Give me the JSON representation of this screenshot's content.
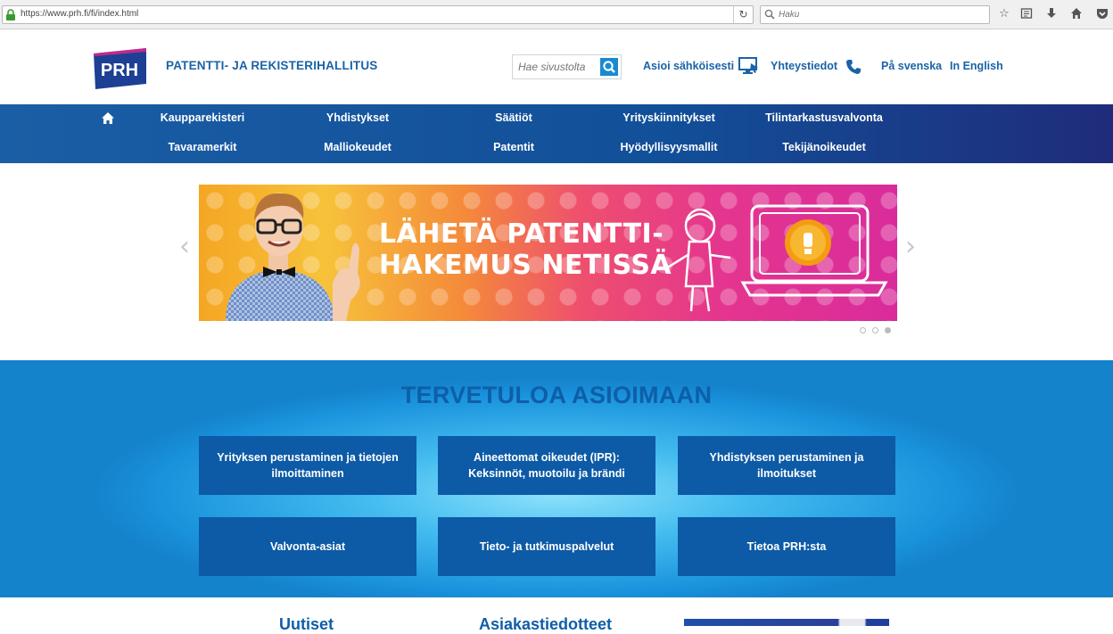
{
  "browser": {
    "url": "https://www.prh.fi/fi/index.html",
    "search_placeholder": "Haku",
    "icons": [
      "lock-icon",
      "reload-icon",
      "search-icon",
      "bookmark-star-icon",
      "reading-list-icon",
      "download-icon",
      "home-icon",
      "pocket-icon"
    ]
  },
  "header": {
    "logo_text": "PRH",
    "site_name": "PATENTTI- JA REKISTERIHALLITUS",
    "search_placeholder": "Hae sivustolta",
    "links": {
      "eservice": "Asioi sähköisesti",
      "contact": "Yhteystiedot",
      "swedish": "På svenska",
      "english": "In English"
    }
  },
  "nav": {
    "row1": [
      "Kaupparekisteri",
      "Yhdistykset",
      "Säätiöt",
      "Yrityskiinnitykset",
      "Tilintarkastusvalvonta"
    ],
    "row2": [
      "Tavaramerkit",
      "Malliokeudet",
      "Patentit",
      "Hyödyllisyysmallit",
      "Tekijänoikeudet"
    ]
  },
  "carousel": {
    "line1": "LÄHETÄ PATENTTI-",
    "line2": "HAKEMUS NETISSÄ",
    "slide_count": 3,
    "active_slide": 3
  },
  "welcome": {
    "title": "TERVETULOA ASIOIMAAN",
    "tiles": [
      "Yrityksen perustaminen ja tietojen ilmoittaminen",
      "Aineettomat oikeudet (IPR): Keksinnöt, muotoilu ja brändi",
      "Yhdistyksen perustaminen ja ilmoitukset",
      "Valvonta-asiat",
      "Tieto- ja tutkimuspalvelut",
      "Tietoa PRH:sta"
    ]
  },
  "bottom": {
    "news": "Uutiset",
    "bulletins": "Asiakastiedotteet"
  },
  "colors": {
    "brand_blue": "#1a63a7",
    "nav_blue": "#1a5ea5",
    "tile_blue": "#0d5aa6"
  }
}
